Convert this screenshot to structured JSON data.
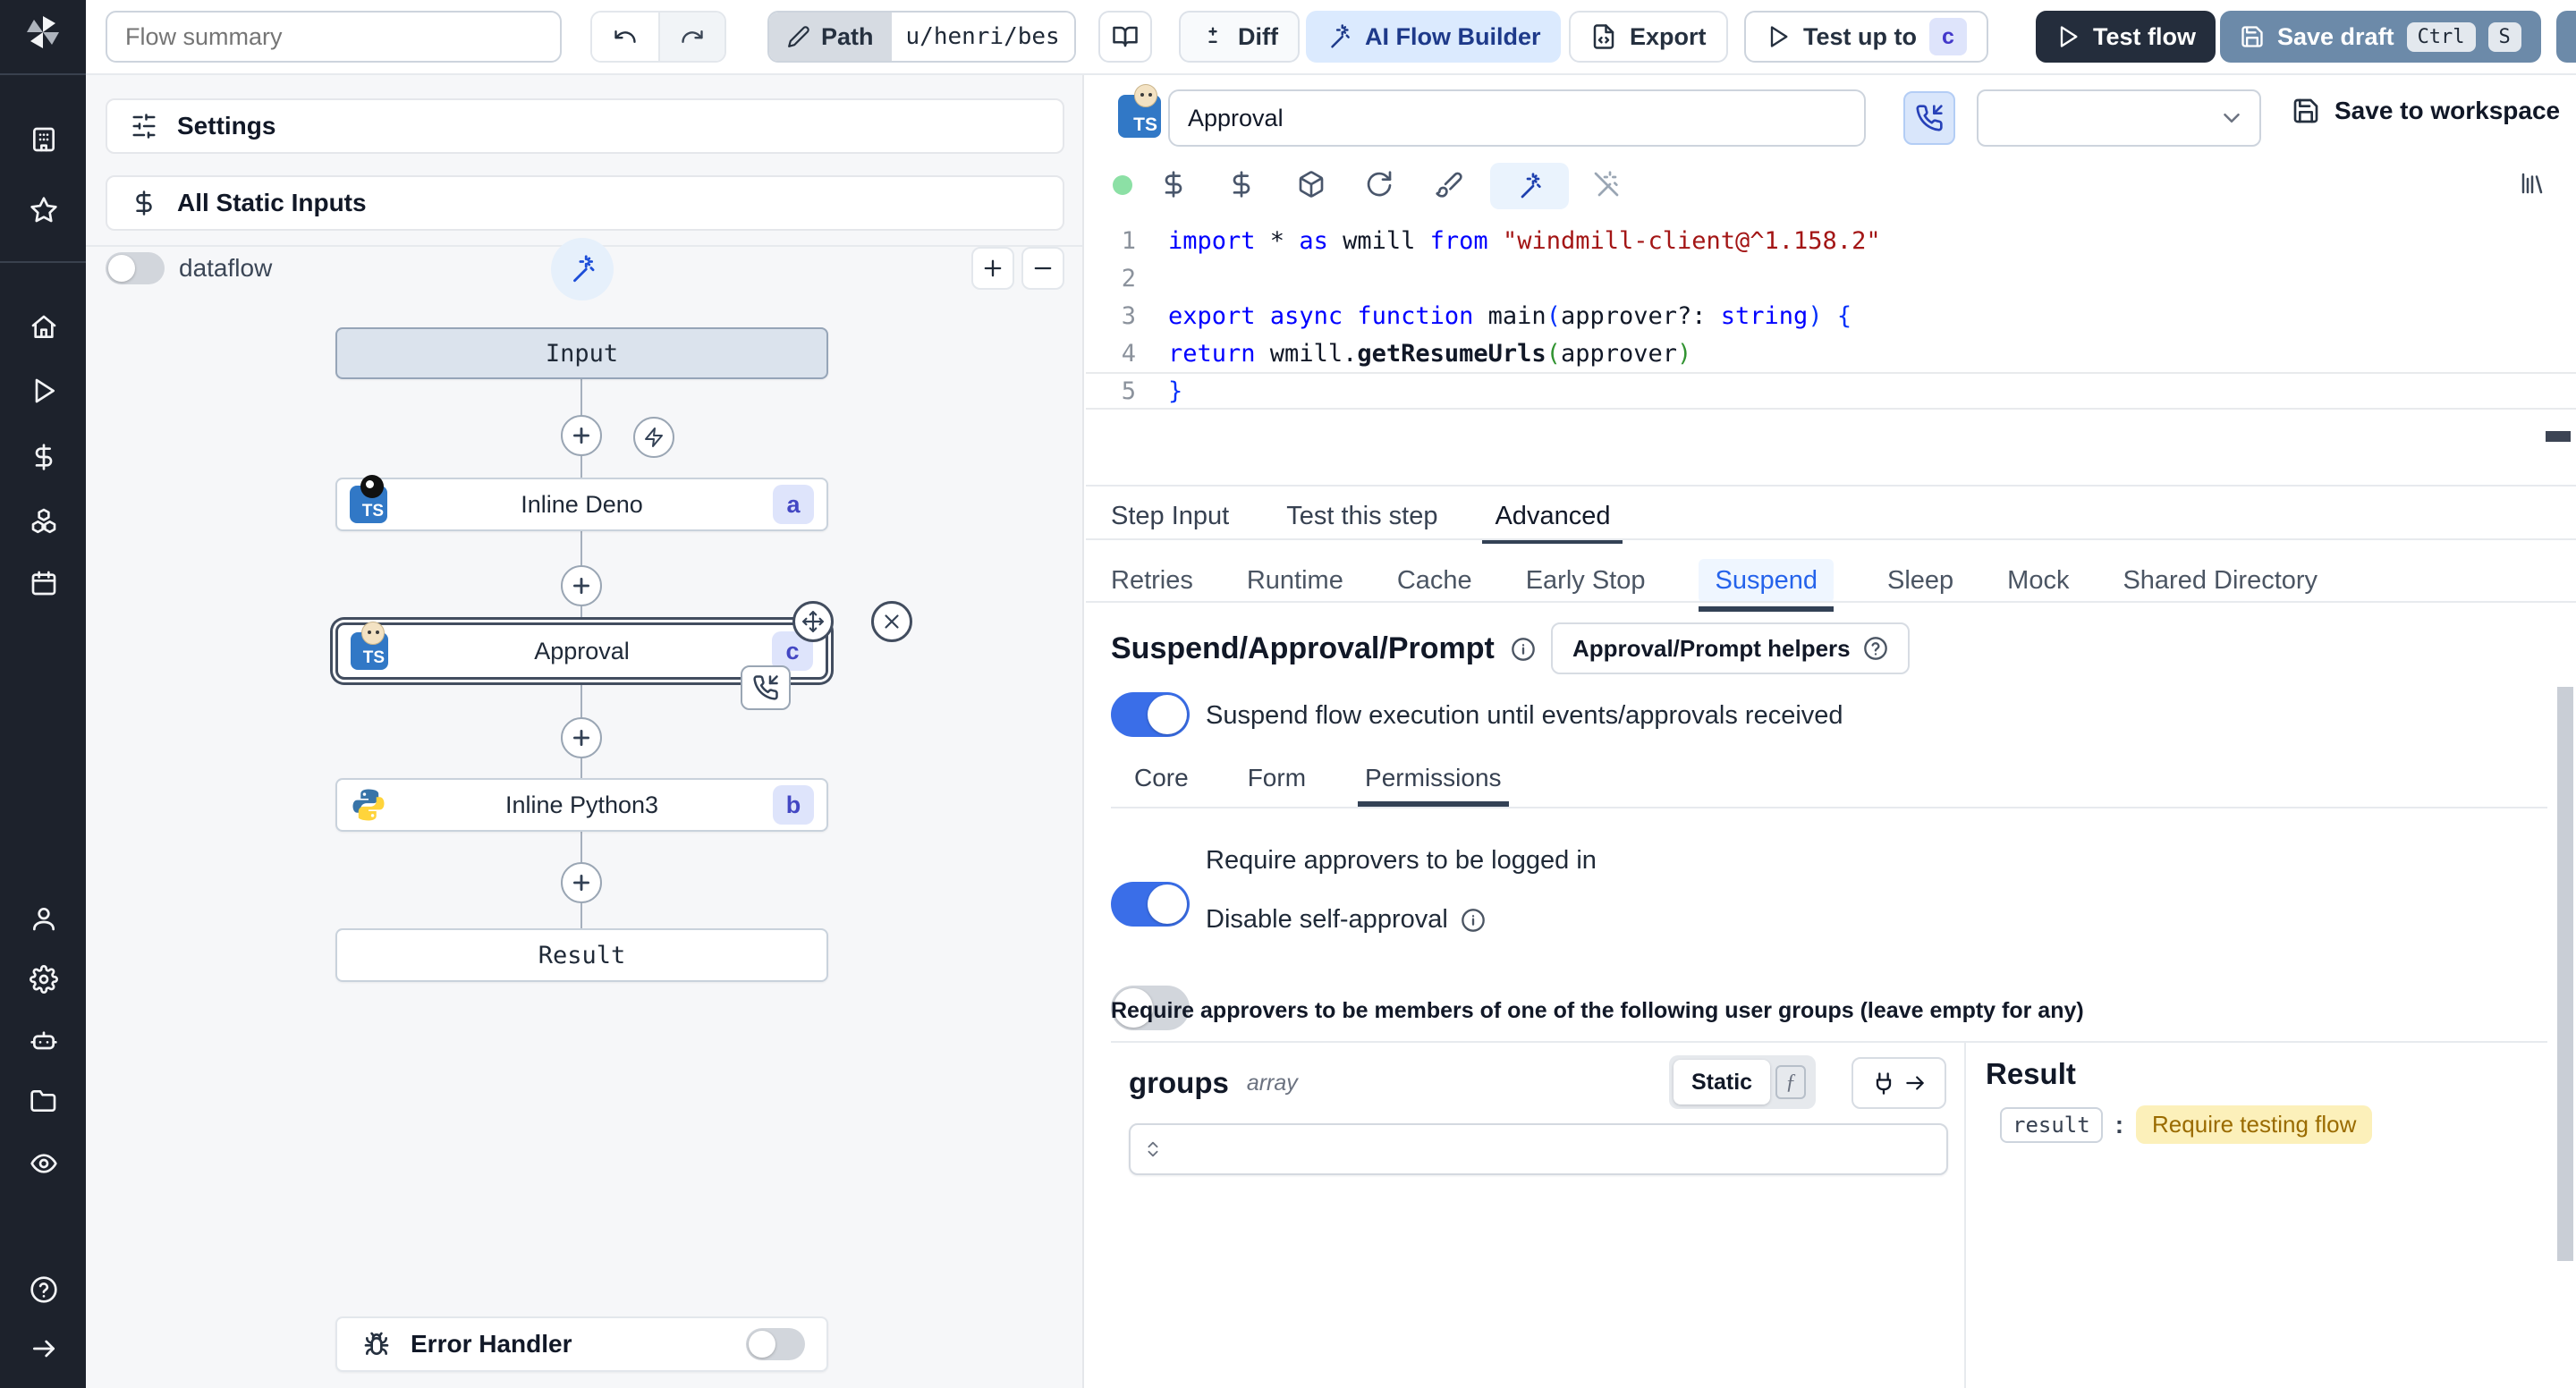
{
  "topbar": {
    "flow_summary_placeholder": "Flow summary",
    "path_label": "Path",
    "path_value": "u/henri/bes",
    "diff_label": "Diff",
    "ai_builder_label": "AI Flow Builder",
    "export_label": "Export",
    "test_up_to_label": "Test up to",
    "test_up_to_badge": "c",
    "test_flow_label": "Test flow",
    "save_draft_label": "Save draft",
    "kbd_ctrl": "Ctrl",
    "kbd_s": "S"
  },
  "sidebar": {
    "icons_top": [
      "windmill-logo",
      "workspace-icon",
      "favorites-icon"
    ],
    "icons_middle": [
      "home-icon",
      "runs-icon",
      "variables-icon",
      "resources-icon",
      "schedules-icon"
    ],
    "icons_lower": [
      "user-icon",
      "settings-icon",
      "workers-icon",
      "folders-icon",
      "audit-icon"
    ],
    "icons_bottom": [
      "help-icon",
      "expand-icon"
    ]
  },
  "flow": {
    "settings_label": "Settings",
    "static_inputs_label": "All Static Inputs",
    "dataflow_label": "dataflow",
    "input_node": "Input",
    "deno_node": {
      "label": "Inline Deno",
      "badge": "a"
    },
    "approval_node": {
      "label": "Approval",
      "badge": "c"
    },
    "python_node": {
      "label": "Inline Python3",
      "badge": "b"
    },
    "result_node": "Result",
    "error_handler_label": "Error Handler"
  },
  "editor": {
    "title_value": "Approval",
    "save_to_workspace_label": "Save to workspace",
    "code": {
      "lines": [
        [
          [
            "kw",
            "import"
          ],
          [
            "pl",
            " * "
          ],
          [
            "kw",
            "as"
          ],
          [
            "pl",
            " wmill "
          ],
          [
            "kw",
            "from"
          ],
          [
            "pl",
            " "
          ],
          [
            "str",
            "\"windmill-client@^1.158.2\""
          ]
        ],
        [],
        [
          [
            "kw",
            "export"
          ],
          [
            "pl",
            " "
          ],
          [
            "kw",
            "async"
          ],
          [
            "pl",
            " "
          ],
          [
            "kw",
            "function"
          ],
          [
            "pl",
            " main"
          ],
          [
            "b1",
            "("
          ],
          [
            "pl",
            "approver?: "
          ],
          [
            "kw",
            "string"
          ],
          [
            "b1",
            ")"
          ],
          [
            "pl",
            " "
          ],
          [
            "b1",
            "{"
          ]
        ],
        [
          [
            "pl",
            "  "
          ],
          [
            "kw",
            "return"
          ],
          [
            "pl",
            " wmill."
          ],
          [
            "fn",
            "getResumeUrls"
          ],
          [
            "b2",
            "("
          ],
          [
            "pl",
            "approver"
          ],
          [
            "b2",
            ")"
          ]
        ],
        [
          [
            "b1",
            "}"
          ]
        ]
      ]
    }
  },
  "tabs": {
    "main": [
      "Step Input",
      "Test this step",
      "Advanced"
    ],
    "advanced": [
      "Retries",
      "Runtime",
      "Cache",
      "Early Stop",
      "Suspend",
      "Sleep",
      "Mock",
      "Shared Directory"
    ]
  },
  "suspend": {
    "heading": "Suspend/Approval/Prompt",
    "helpers_label": "Approval/Prompt helpers",
    "suspend_toggle_label": "Suspend flow execution until events/approvals received",
    "subtabs": [
      "Core",
      "Form",
      "Permissions"
    ],
    "logged_in_label": "Require approvers to be logged in",
    "self_approval_label": "Disable self-approval",
    "groups_note": "Require approvers to be members of one of the following user groups (leave empty for any)",
    "groups_label": "groups",
    "groups_type": "array",
    "static_label": "Static",
    "fn_glyph": "ƒ",
    "result_title": "Result",
    "result_key": "result",
    "result_value": "Require testing flow"
  },
  "colors": {
    "sidebar_bg": "#1d222c",
    "accent_blue": "#2563eb",
    "toggle_on": "#3a6ee8",
    "ai_button_bg": "#dbeafe",
    "ai_button_text": "#1e3a8a",
    "test_flow_bg": "#242d3c",
    "save_draft_bg": "#6c8aa9",
    "step_chip_bg": "#dee4fb",
    "step_chip_text": "#4347c3",
    "result_badge_bg": "#fcf0ba",
    "result_badge_text": "#9a6b00",
    "code_keyword": "#0000ff",
    "code_string": "#a31515"
  }
}
